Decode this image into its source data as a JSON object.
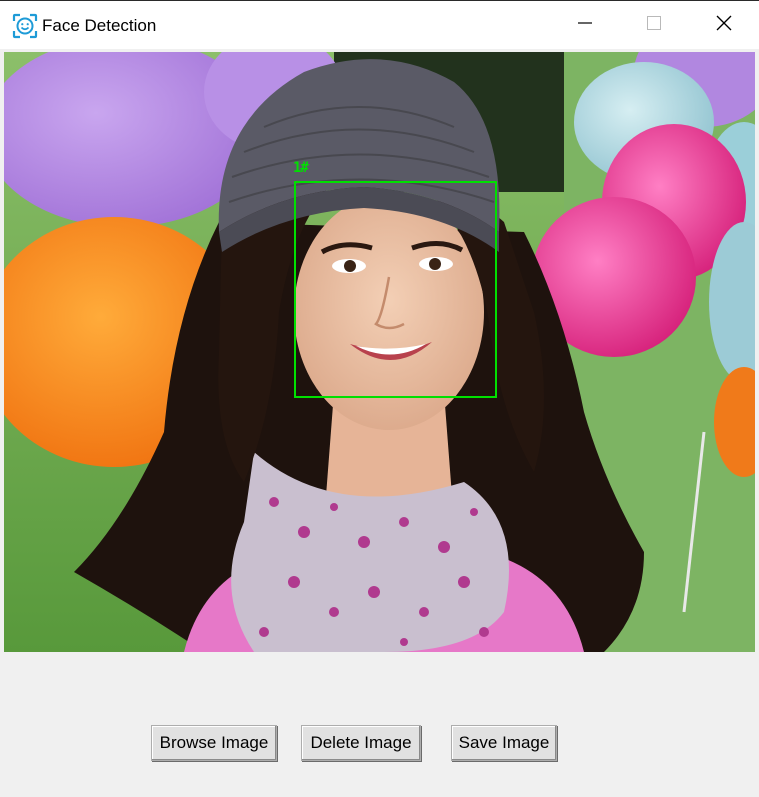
{
  "window": {
    "title": "Face Detection",
    "icon": "face-scan-icon",
    "controls": [
      "minimize-icon",
      "maximize-icon",
      "close-icon"
    ]
  },
  "image_view": {
    "detections": [
      {
        "label": "1#"
      }
    ],
    "box_color": "#00e000"
  },
  "buttons": {
    "browse": "Browse Image",
    "delete": "Delete Image",
    "save": "Save Image"
  }
}
